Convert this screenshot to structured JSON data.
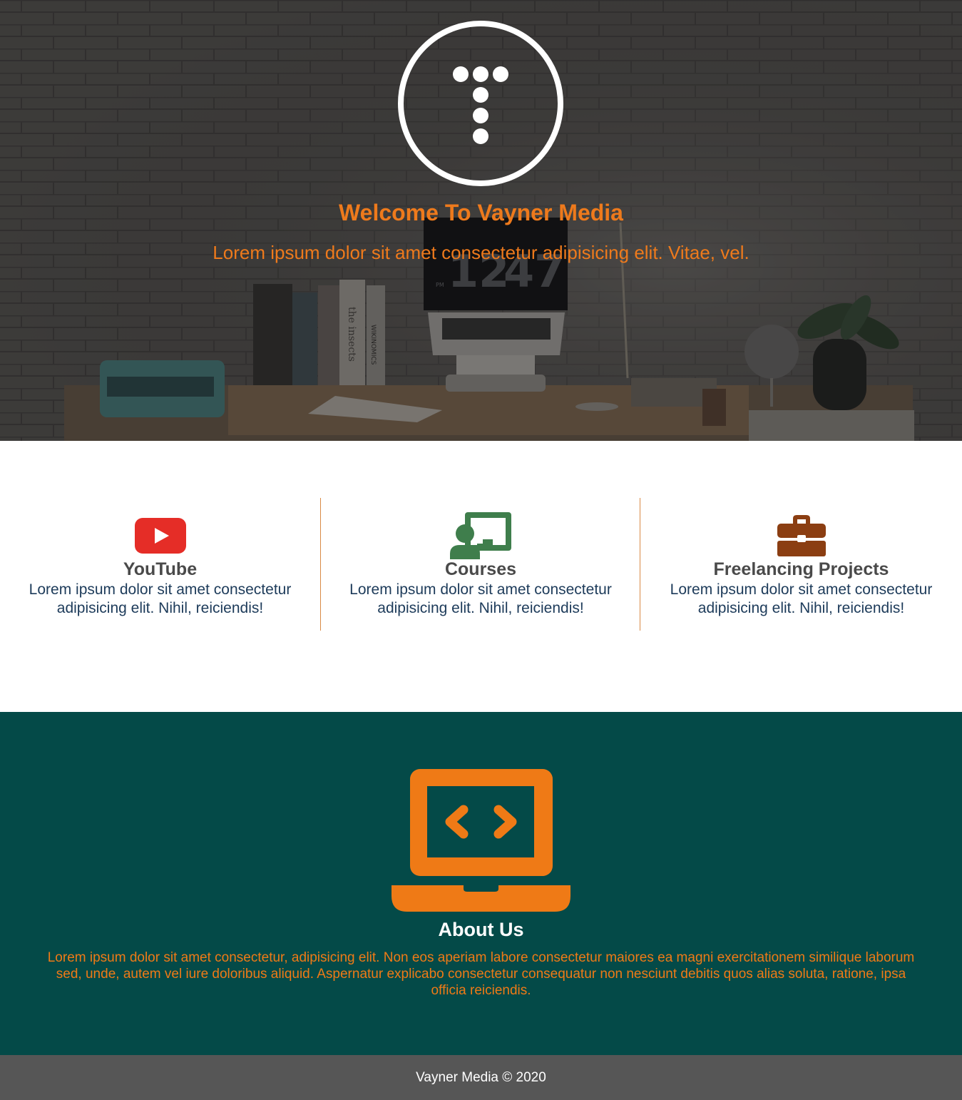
{
  "hero": {
    "title": "Welcome To Vayner Media",
    "subtitle": "Lorem ipsum dolor sit amet consectetur adipisicing elit. Vitae, vel.",
    "clock_hour": "12",
    "clock_minute": "47",
    "clock_ampm": "PM",
    "book_spine_1": "the insects",
    "book_spine_2": "WIKINOMICS"
  },
  "services": [
    {
      "icon": "youtube-icon",
      "title": "YouTube",
      "description": "Lorem ipsum dolor sit amet consectetur adipisicing elit. Nihil, reiciendis!"
    },
    {
      "icon": "chalkboard-teacher-icon",
      "title": "Courses",
      "description": "Lorem ipsum dolor sit amet consectetur adipisicing elit. Nihil, reiciendis!"
    },
    {
      "icon": "briefcase-icon",
      "title": "Freelancing Projects",
      "description": "Lorem ipsum dolor sit amet consectetur adipisicing elit. Nihil, reiciendis!"
    }
  ],
  "about": {
    "icon": "laptop-code-icon",
    "title": "About Us",
    "text": "Lorem ipsum dolor sit amet consectetur, adipisicing elit. Non eos aperiam labore consectetur maiores ea magni exercitationem similique laborum sed, unde, autem vel iure doloribus aliquid. Aspernatur explicabo consectetur consequatur non nesciunt debitis quos alias soluta, ratione, ipsa officia reiciendis."
  },
  "footer": {
    "text": "Vayner Media © 2020"
  },
  "colors": {
    "accent": "#ee7a1c",
    "about_bg": "#044a48",
    "footer_bg": "#565656",
    "youtube": "#e52d27",
    "courses": "#3f7e4c",
    "briefcase": "#8b3e12"
  }
}
